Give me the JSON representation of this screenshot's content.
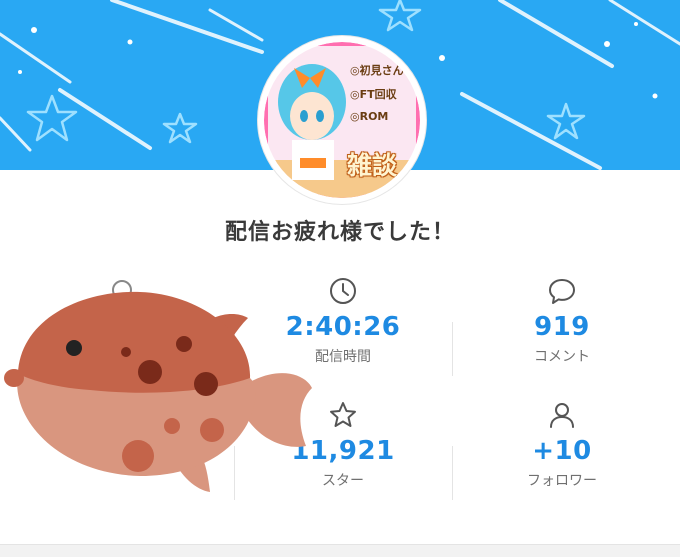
{
  "header": {
    "banner_color": "#29a8f3",
    "avatar_lines": [
      "◎初見さん",
      "◎FT回収",
      "◎ROM"
    ],
    "avatar_title": "雑談"
  },
  "title": "配信お疲れ様でした！",
  "stats": {
    "duration": {
      "value": "2:40:26",
      "label": "配信時間",
      "icon": "clock-icon"
    },
    "comments": {
      "value": "919",
      "label": "コメント",
      "icon": "speech-bubble-icon"
    },
    "stars": {
      "value": "11,921",
      "label": "スター",
      "icon": "star-icon"
    },
    "followers": {
      "value": "+10",
      "label": "フォロワー",
      "icon": "person-icon"
    }
  },
  "accent_color": "#1e8ae2",
  "overlay": {
    "icon": "pufferfish-icon"
  }
}
